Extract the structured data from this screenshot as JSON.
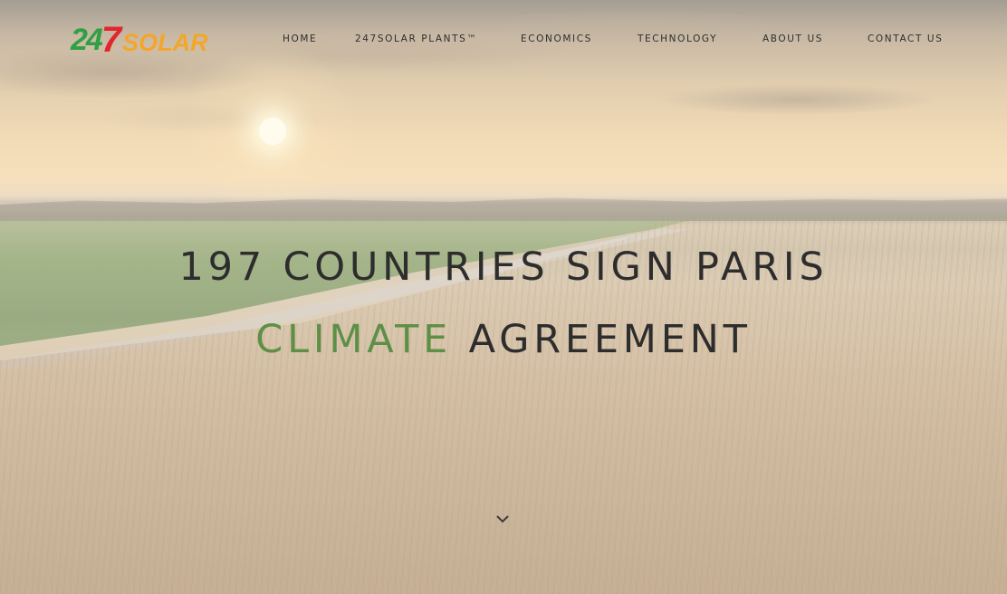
{
  "brand": {
    "logo_digit_1": "2",
    "logo_digit_2": "4",
    "logo_digit_3": "7",
    "logo_word": "SOLAR",
    "colors": {
      "green": "#2fa043",
      "red": "#e3262d",
      "orange": "#f3a62a"
    }
  },
  "nav": {
    "items": [
      {
        "label": "HOME"
      },
      {
        "label": "247SOLAR PLANTS™"
      },
      {
        "label": "ECONOMICS"
      },
      {
        "label": "TECHNOLOGY"
      },
      {
        "label": "ABOUT US"
      },
      {
        "label": "CONTACT US"
      }
    ]
  },
  "hero": {
    "line1": "197 COUNTRIES SIGN PARIS",
    "accent": "CLIMATE",
    "line2_rest": "AGREEMENT",
    "accent_color": "#5e8f47",
    "text_color": "#2d2d2d"
  },
  "scroll": {
    "icon": "chevron-down-icon"
  }
}
